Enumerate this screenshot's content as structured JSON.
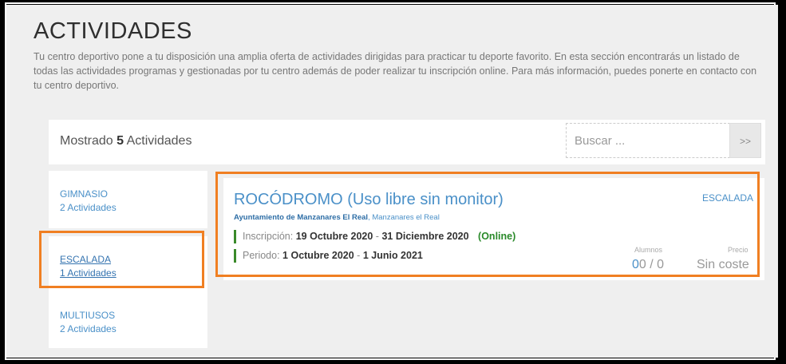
{
  "page": {
    "title": "ACTIVIDADES",
    "intro": "Tu centro deportivo pone a tu disposición una amplia oferta de actividades dirigidas para practicar tu deporte favorito. En esta sección encontrarás un listado de todas las actividades programas y gestionadas por tu centro además de poder realizar tu inscripción online. Para más información, puedes ponerte en contacto con tu centro deportivo."
  },
  "summary": {
    "prefix": "Mostrado",
    "count": "5",
    "suffix": "Actividades"
  },
  "search": {
    "placeholder": "Buscar ...",
    "button": ">>"
  },
  "categories": [
    {
      "name": "GIMNASIO",
      "count": "2 Actividades"
    },
    {
      "name": "ESCALADA",
      "count": "1 Actividades"
    },
    {
      "name": "MULTIUSOS",
      "count": "2 Actividades"
    }
  ],
  "activity": {
    "title": "ROCÓDROMO (Uso libre sin monitor)",
    "organizer": "Ayuntamiento de Manzanares El Real",
    "location": ", Manzanares el Real",
    "category": "ESCALADA",
    "inscription_label": "Inscripción:",
    "inscription_start": "19 Octubre 2020",
    "inscription_end": "31 Diciembre 2020",
    "online": "(Online)",
    "period_label": "Periodo:",
    "period_start": "1 Octubre 2020",
    "period_end": "1 Junio 2021",
    "dash": "-",
    "students_label": "Alumnos",
    "students_enrolled": "0",
    "students_max": "0 / 0",
    "price_label": "Precio",
    "price": "Sin coste"
  },
  "colors": {
    "highlight": "#f07f22",
    "link": "#4a90c8",
    "online_green": "#2a8a2a"
  }
}
